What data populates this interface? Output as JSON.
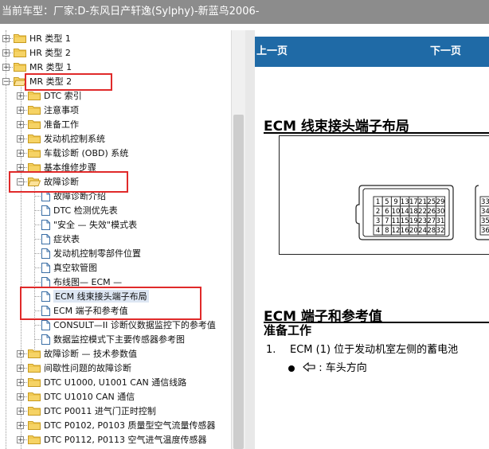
{
  "window": {
    "title": "当前车型：厂家:D-东风日产轩逸(Sylphy)-新蓝鸟2006-"
  },
  "tree": {
    "nodes": [
      {
        "id": "n0",
        "label": "HR 类型 1",
        "expander": "+",
        "icon": "folder-icon"
      },
      {
        "id": "n1",
        "label": "HR 类型 2",
        "expander": "+",
        "icon": "folder-icon"
      },
      {
        "id": "n2",
        "label": "MR 类型 1",
        "expander": "+",
        "icon": "folder-icon"
      },
      {
        "id": "n3",
        "label": "MR 类型 2",
        "expander": "−",
        "icon": "folder-open-icon"
      },
      {
        "id": "n4",
        "label": "DTC 索引",
        "expander": "+",
        "icon": "folder-icon"
      },
      {
        "id": "n5",
        "label": "注意事项",
        "expander": "+",
        "icon": "folder-icon"
      },
      {
        "id": "n6",
        "label": "准备工作",
        "expander": "+",
        "icon": "folder-icon"
      },
      {
        "id": "n7",
        "label": "发动机控制系统",
        "expander": "+",
        "icon": "folder-icon"
      },
      {
        "id": "n8",
        "label": "车载诊断 (OBD) 系统",
        "expander": "+",
        "icon": "folder-icon"
      },
      {
        "id": "n9",
        "label": "基本维修步骤",
        "expander": "+",
        "icon": "folder-icon"
      },
      {
        "id": "n10",
        "label": "故障诊断",
        "expander": "−",
        "icon": "folder-open-icon"
      },
      {
        "id": "n11",
        "label": "故障诊断介绍",
        "icon": "document-icon"
      },
      {
        "id": "n12",
        "label": "DTC 检测优先表",
        "icon": "document-icon"
      },
      {
        "id": "n13",
        "label": "\"安全 — 失效\"模式表",
        "icon": "document-icon"
      },
      {
        "id": "n14",
        "label": "症状表",
        "icon": "document-icon"
      },
      {
        "id": "n15",
        "label": "发动机控制零部件位置",
        "icon": "document-icon"
      },
      {
        "id": "n16",
        "label": "真空软管图",
        "icon": "document-icon"
      },
      {
        "id": "n17",
        "label": "布线图— ECM —",
        "icon": "document-icon"
      },
      {
        "id": "n18",
        "label": "ECM 线束接头端子布局",
        "icon": "document-icon"
      },
      {
        "id": "n19",
        "label": "ECM 端子和参考值",
        "icon": "document-icon"
      },
      {
        "id": "n20",
        "label": "CONSULT—II 诊断仪数据监控下的参考值",
        "icon": "document-icon"
      },
      {
        "id": "n21",
        "label": "数据监控模式下主要传感器参考图",
        "icon": "document-icon"
      },
      {
        "id": "n22",
        "label": "故障诊断 — 技术参数值",
        "expander": "+",
        "icon": "folder-icon"
      },
      {
        "id": "n23",
        "label": "间歇性问题的故障诊断",
        "expander": "+",
        "icon": "folder-icon"
      },
      {
        "id": "n24",
        "label": "DTC U1000, U1001 CAN 通信线路",
        "expander": "+",
        "icon": "folder-icon"
      },
      {
        "id": "n25",
        "label": "DTC U1010 CAN 通信",
        "expander": "+",
        "icon": "folder-icon"
      },
      {
        "id": "n26",
        "label": "DTC P0011 进气门正时控制",
        "expander": "+",
        "icon": "folder-icon"
      },
      {
        "id": "n27",
        "label": "DTC P0102, P0103 质量型空气流量传感器",
        "expander": "+",
        "icon": "folder-icon"
      },
      {
        "id": "n28",
        "label": "DTC P0112, P0113 空气进气温度传感器",
        "expander": "+",
        "icon": "folder-icon"
      }
    ]
  },
  "content": {
    "prev_label": "上一页",
    "next_label": "下一页",
    "heading1": "ECM 线束接头端子布局",
    "connector_pins": [
      [
        "1",
        "5",
        "9",
        "13",
        "17",
        "21",
        "25",
        "29"
      ],
      [
        "2",
        "6",
        "10",
        "14",
        "18",
        "22",
        "26",
        "30"
      ],
      [
        "3",
        "7",
        "11",
        "15",
        "19",
        "23",
        "27",
        "31"
      ],
      [
        "4",
        "8",
        "12",
        "16",
        "20",
        "24",
        "28",
        "32"
      ]
    ],
    "connector2_pins": [
      "33",
      "34",
      "35",
      "36"
    ],
    "heading2": "ECM 端子和参考值",
    "prep_heading": "准备工作",
    "step1_num": "1.",
    "step1_text": "ECM (1) 位于发动机室左侧的蓄电池",
    "bullet_text": ": 车头方向",
    "bullet_icon": "arrow-left-outline-icon"
  }
}
